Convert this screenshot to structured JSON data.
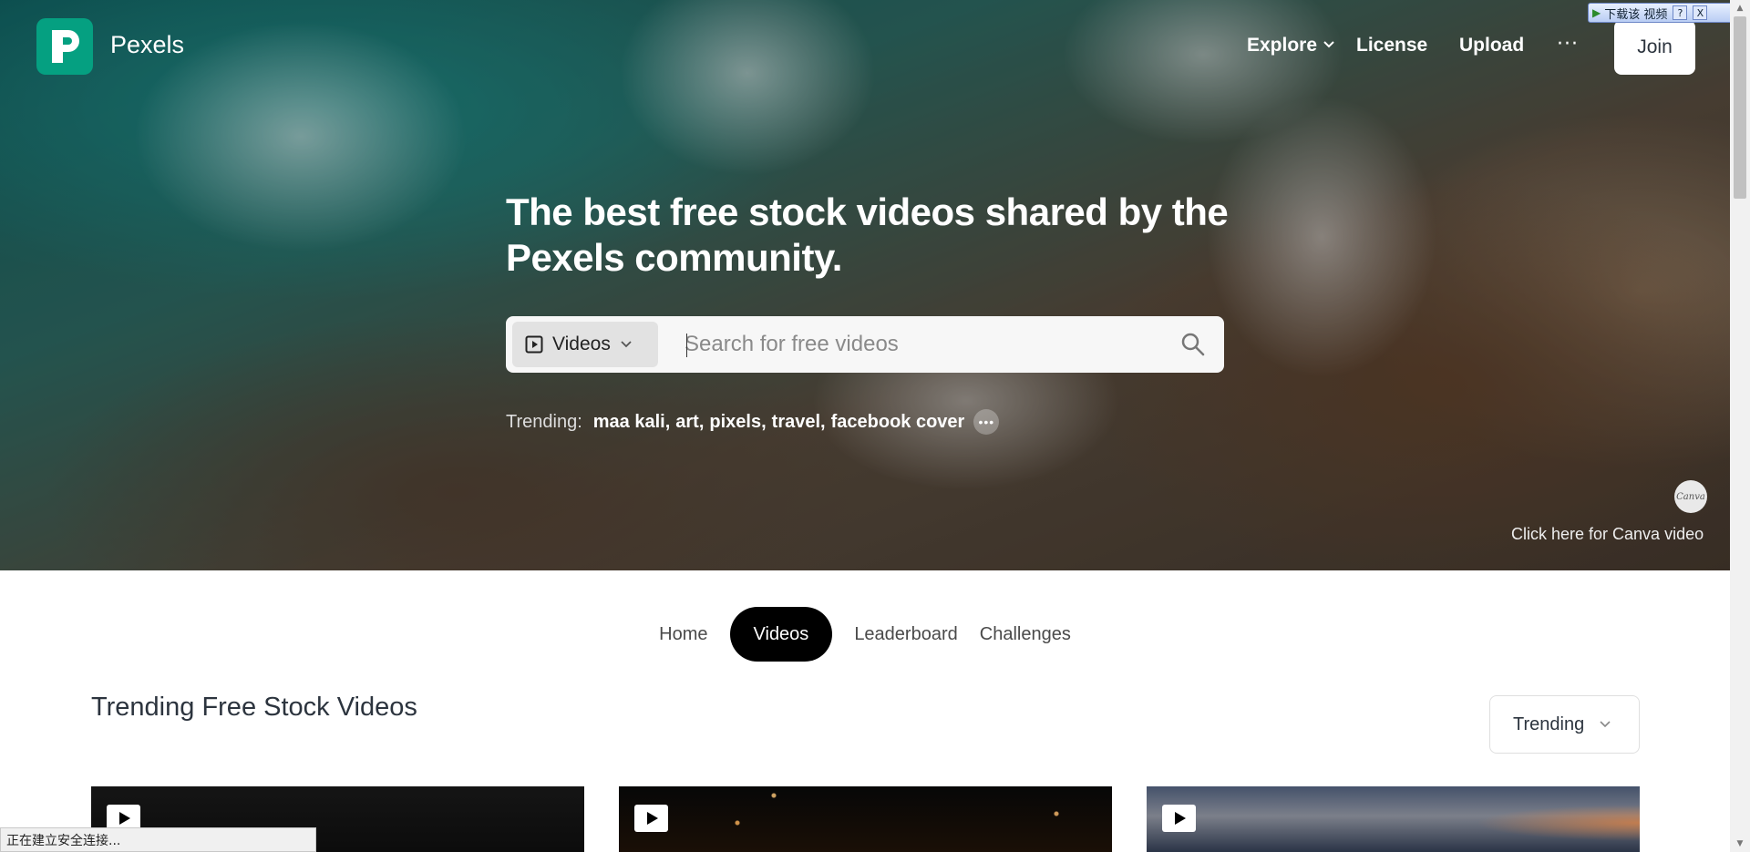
{
  "header": {
    "brand": "Pexels",
    "nav": {
      "explore": "Explore",
      "license": "License",
      "upload": "Upload",
      "more": "···",
      "join": "Join"
    }
  },
  "download_widget": {
    "label": "下载该 视频",
    "help": "?",
    "close": "X"
  },
  "hero": {
    "headline": "The best free stock videos shared by the Pexels community.",
    "search": {
      "type_label": "Videos",
      "placeholder": "Search for free videos",
      "value": ""
    },
    "trending": {
      "label": "Trending:",
      "terms": [
        "maa kali",
        "art",
        "pixels",
        "travel",
        "facebook cover"
      ]
    },
    "canva": {
      "badge": "Canva",
      "link": "Click here for Canva video"
    }
  },
  "tabs": [
    {
      "label": "Home",
      "active": false
    },
    {
      "label": "Videos",
      "active": true
    },
    {
      "label": "Leaderboard",
      "active": false
    },
    {
      "label": "Challenges",
      "active": false
    }
  ],
  "section": {
    "title": "Trending Free Stock Videos",
    "sort": "Trending"
  },
  "status_bar": "正在建立安全连接...",
  "colors": {
    "brand": "#05a081",
    "active_tab": "#000000",
    "text": "#2c343e"
  }
}
